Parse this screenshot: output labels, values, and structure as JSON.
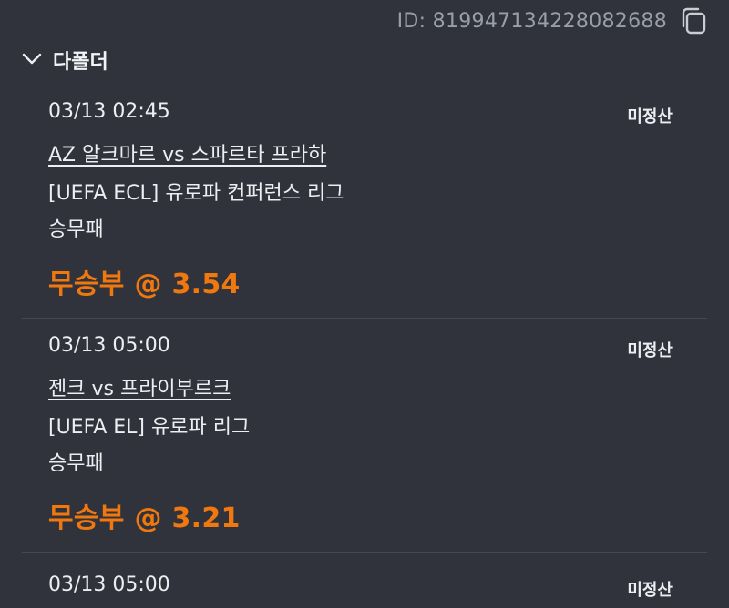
{
  "header": {
    "id_label": "ID: 819947134228082688",
    "copy_icon": "copy-icon"
  },
  "section": {
    "title": "다폴더",
    "chevron_icon": "chevron-down-icon"
  },
  "bets": [
    {
      "datetime": "03/13 02:45",
      "status": "미정산",
      "match": "AZ 알크마르 vs 스파르타 프라하",
      "league": "[UEFA ECL] 유로파 컨퍼런스 리그",
      "market": "승무패",
      "pick": "무승부 @ 3.54"
    },
    {
      "datetime": "03/13 05:00",
      "status": "미정산",
      "match": "젠크 vs 프라이부르크",
      "league": "[UEFA EL] 유로파 리그",
      "market": "승무패",
      "pick": "무승부 @ 3.21"
    },
    {
      "datetime": "03/13 05:00",
      "status": "미정산"
    }
  ],
  "colors": {
    "background": "#30333c",
    "accent": "#f0780f",
    "divider": "#454954",
    "muted": "#9a9ea8"
  }
}
